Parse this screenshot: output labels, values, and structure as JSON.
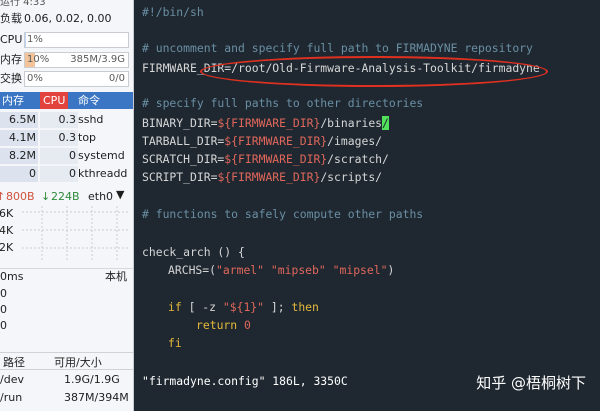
{
  "sidebar": {
    "top_partial": "运行 4:33",
    "load_label": "负载",
    "load_values": "0.06, 0.02, 0.00",
    "meters": [
      {
        "label": "CPU",
        "text": "1%",
        "text_right": "",
        "fill_percent": 1,
        "color": "#bcd7f2"
      },
      {
        "label": "内存",
        "text": "10%",
        "text_right": "385M/3.9G",
        "fill_percent": 10,
        "color": "#f3c49a"
      },
      {
        "label": "交换",
        "text": "0%",
        "text_right": "0/0",
        "fill_percent": 0,
        "color": "#d9e8c6"
      }
    ],
    "process_table": {
      "headers": [
        "内存",
        "CPU",
        "命令"
      ],
      "rows": [
        {
          "mem": "6.5M",
          "cpu": "0.3",
          "cmd": "sshd"
        },
        {
          "mem": "4.1M",
          "cpu": "0.3",
          "cmd": "top"
        },
        {
          "mem": "8.2M",
          "cpu": "0",
          "cmd": "systemd"
        },
        {
          "mem": "0",
          "cpu": "0",
          "cmd": "kthreadd"
        }
      ]
    },
    "network": {
      "up": "800B",
      "down": "224B",
      "interface": "eth0",
      "scale_labels": [
        "6K",
        "4K",
        "2K"
      ]
    },
    "latency": {
      "label": "0ms",
      "host": "本机",
      "values": [
        "0",
        "0",
        "0"
      ]
    },
    "disk_table": {
      "headers": [
        "路径",
        "可用/大小"
      ],
      "rows": [
        {
          "path": "/dev",
          "size": "1.9G/1.9G"
        },
        {
          "path": "/run",
          "size": "387M/394M"
        }
      ]
    }
  },
  "editor": {
    "shebang": "#!/bin/sh",
    "comment1": "# uncomment and specify full path to FIRMADYNE repository",
    "firmware_var": "FIRMWARE_DIR=",
    "firmware_path": "/root/Old-Firmware-Analysis-Toolkit/firmadyne",
    "comment2": "# specify full paths to other directories",
    "binary_var": "BINARY_DIR=",
    "tarball_var": "TARBALL_DIR=",
    "scratch_var": "SCRATCH_DIR=",
    "script_var": "SCRIPT_DIR=",
    "dir_ref": "${FIRMWARE_DIR}",
    "binaries_suffix": "/binaries",
    "cursor_char": "/",
    "images_suffix": "/images/",
    "scratch_suffix": "/scratch/",
    "scripts_suffix": "/scripts/",
    "comment3": "# functions to safely compute other paths",
    "check_arch": "check_arch () {",
    "archs_var": "ARCHS=(",
    "arch1": "\"armel\"",
    "arch2": "\"mipseb\"",
    "arch3": "\"mipsel\"",
    "archs_close": ")",
    "if_kw": "if",
    "if_mid": "[ -z ",
    "if_str": "\"${1}\"",
    "if_end": " ];",
    "then_kw": "then",
    "return_kw": "return",
    "return_val": "0",
    "fi_kw": "fi",
    "status_line": "\"firmadyne.config\" 186L, 3350C"
  },
  "watermark": "知乎 @梧桐树下",
  "colors": {
    "editor_bg": "#1f2831",
    "comment": "#6a8fa3",
    "string": "#e0675a",
    "keyword": "#e4b83a",
    "annotation": "#e03020",
    "cursor": "#50e05a",
    "header_bg": "#3a76c4",
    "sort_column": "#e2433d"
  }
}
